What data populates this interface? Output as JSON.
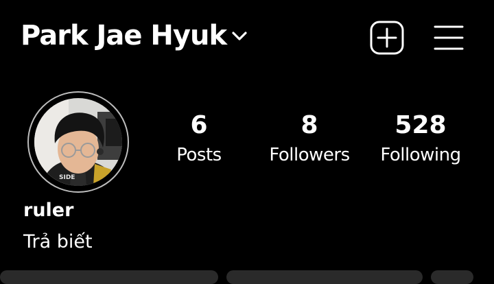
{
  "header": {
    "username": "Park Jae Hyuk",
    "account_switch_icon": "chevron-down-icon",
    "new_post_icon": "plus-square-icon",
    "menu_icon": "hamburger-menu-icon"
  },
  "profile": {
    "avatar_icon": "profile-photo",
    "stats": [
      {
        "value": "6",
        "label": "Posts"
      },
      {
        "value": "8",
        "label": "Followers"
      },
      {
        "value": "528",
        "label": "Following"
      }
    ],
    "display_name": "ruler",
    "bio": "Trả biết"
  },
  "colors": {
    "background": "#000000",
    "text": "#ffffff",
    "avatar_ring": "#bdbdbd",
    "button": "#2a2a2a"
  }
}
